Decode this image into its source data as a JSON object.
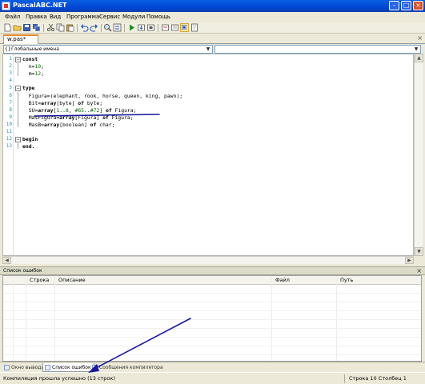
{
  "window": {
    "title": "PascalABC.NET"
  },
  "menu": [
    "Файл",
    "Правка",
    "Вид",
    "Программа",
    "Сервис",
    "Модули",
    "Помощь"
  ],
  "toolbar_icons": [
    "new-file-icon",
    "open-icon",
    "save-icon",
    "save-all-icon",
    "cut-icon",
    "copy-icon",
    "paste-icon",
    "undo-icon",
    "redo-icon",
    "find-icon",
    "replace-icon",
    "run-icon",
    "step-into-icon",
    "stop-icon",
    "debug-icon",
    "compile-icon",
    "options-icon",
    "help-icon"
  ],
  "tab": {
    "label": "w.pas*"
  },
  "scope": {
    "label": "Глобальные имена",
    "member": ""
  },
  "editor": {
    "line_numbers": [
      "1",
      "2",
      "3",
      "4",
      "5",
      "6",
      "7",
      "8",
      "9",
      "10",
      "11",
      "12",
      "13"
    ],
    "lines": [
      {
        "kw": "const",
        "rest": ""
      },
      {
        "kw": "",
        "rest": "  n=10;"
      },
      {
        "kw": "",
        "rest": "  m=12;"
      },
      {
        "kw": "",
        "rest": ""
      },
      {
        "kw": "type",
        "rest": ""
      },
      {
        "kw": "",
        "rest": "  Figura=(elephant, rook, horse, queen, king, pawn);"
      },
      {
        "kw": "",
        "rest": "  Bit=array[byte] of byte;"
      },
      {
        "kw": "",
        "rest": "  SU=array[1..8, #65..#72] of Figura;"
      },
      {
        "kw": "",
        "rest": "  MasFigura=array[Figura] of Figura;"
      },
      {
        "kw": "",
        "rest": "  MasB=array[boolean] of char;"
      },
      {
        "kw": "",
        "rest": ""
      },
      {
        "kw": "begin",
        "rest": ""
      },
      {
        "kw": "end.",
        "rest": ""
      }
    ]
  },
  "errors_panel": {
    "title": "Список ошибок",
    "columns": [
      "",
      "Строка",
      "Описание",
      "Файл",
      "Путь"
    ]
  },
  "bottom_tabs": [
    "Окно вывода",
    "Список ошибок",
    "Сообщения компилятора"
  ],
  "status": {
    "message": "Компиляция прошла успешно (13 строк)",
    "line_label": "Строка",
    "line_value": "10",
    "col_label": "Столбец",
    "col_value": "1"
  },
  "colors": {
    "annotation": "#1a1a9c",
    "titlebar": "#0a5fe0"
  }
}
